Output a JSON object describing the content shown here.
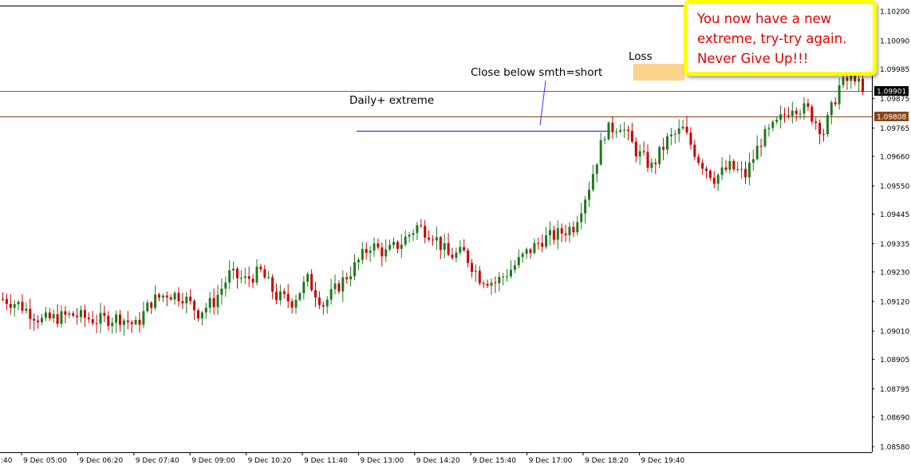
{
  "chart_data": {
    "type": "candlestick",
    "colors": {
      "bull": "#1f7a1f",
      "bear": "#cc0000",
      "grid": "#000000",
      "extreme": "#000000",
      "support": "#8b4513",
      "smth": "#3333ff",
      "loss_zone": "#fbd38d"
    },
    "y_ticks": [
      "1.10200",
      "1.10090",
      "1.09985",
      "1.09875",
      "1.09765",
      "1.09660",
      "1.09550",
      "1.09445",
      "1.09335",
      "1.09230",
      "1.09120",
      "1.09010",
      "1.08905",
      "1.08795",
      "1.08690",
      "1.08580"
    ],
    "x_ticks": [
      ":40",
      "9 Dec 05:00",
      "9 Dec 06:20",
      "9 Dec 07:40",
      "9 Dec 09:00",
      "9 Dec 10:20",
      "9 Dec 11:40",
      "9 Dec 13:00",
      "9 Dec 14:20",
      "9 Dec 15:40",
      "9 Dec 17:00",
      "9 Dec 18:20",
      "9 Dec 19:40"
    ],
    "ylim": [
      1.0858,
      1.102
    ],
    "price_labels": [
      {
        "text": "1.09901",
        "price": 1.09901,
        "style": "black"
      },
      {
        "text": "1.09808",
        "price": 1.09808,
        "style": "brown"
      }
    ],
    "annotations": {
      "extreme_label": "Daily+ extreme",
      "smth_label": "Close below smth=short",
      "loss_label": "Loss"
    },
    "callout": [
      "You now have a new",
      "extreme, try-try again.",
      "Never Give Up!!!"
    ],
    "key_points": [
      [
        0,
        1.0913
      ],
      [
        4,
        1.0911
      ],
      [
        10,
        1.0905
      ],
      [
        18,
        1.0907
      ],
      [
        24,
        1.0905
      ],
      [
        30,
        1.0906
      ],
      [
        34,
        1.0903
      ],
      [
        38,
        1.0912
      ],
      [
        42,
        1.0915
      ],
      [
        46,
        1.0914
      ],
      [
        50,
        1.0908
      ],
      [
        54,
        1.0912
      ],
      [
        58,
        1.0922
      ],
      [
        62,
        1.092
      ],
      [
        66,
        1.0923
      ],
      [
        70,
        1.0914
      ],
      [
        74,
        1.0912
      ],
      [
        78,
        1.092
      ],
      [
        82,
        1.0911
      ],
      [
        86,
        1.0918
      ],
      [
        90,
        1.0925
      ],
      [
        94,
        1.0933
      ],
      [
        98,
        1.093
      ],
      [
        102,
        1.0934
      ],
      [
        106,
        1.094
      ],
      [
        110,
        1.0937
      ],
      [
        114,
        1.0929
      ],
      [
        118,
        1.093
      ],
      [
        122,
        1.0921
      ],
      [
        126,
        1.0919
      ],
      [
        130,
        1.0924
      ],
      [
        134,
        1.093
      ],
      [
        138,
        1.0935
      ],
      [
        142,
        1.0937
      ],
      [
        146,
        1.094
      ],
      [
        150,
        1.0955
      ],
      [
        154,
        1.0975
      ],
      [
        158,
        1.0978
      ],
      [
        162,
        1.0968
      ],
      [
        166,
        1.0962
      ],
      [
        170,
        1.0972
      ],
      [
        174,
        1.0976
      ],
      [
        178,
        1.0965
      ],
      [
        182,
        1.0958
      ],
      [
        186,
        1.0962
      ],
      [
        190,
        1.0959
      ],
      [
        194,
        1.0972
      ],
      [
        198,
        1.0978
      ],
      [
        202,
        1.0985
      ],
      [
        206,
        1.0983
      ],
      [
        210,
        1.0975
      ],
      [
        214,
        1.0992
      ],
      [
        218,
        1.0996
      ],
      [
        220,
        1.0989
      ]
    ]
  }
}
